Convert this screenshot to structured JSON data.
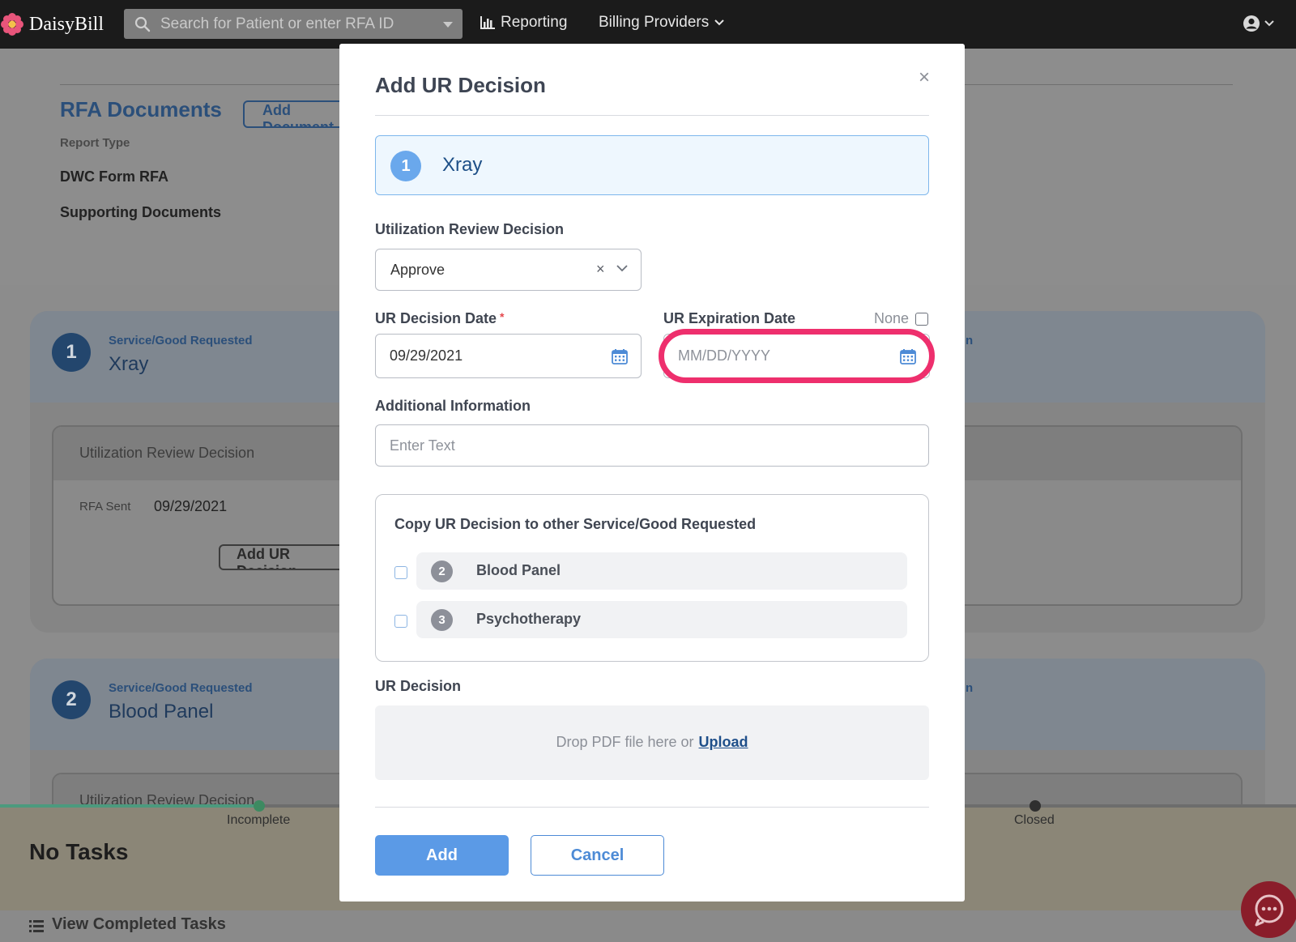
{
  "app": {
    "name": "DaisyBill",
    "search_placeholder": "Search for Patient or enter RFA ID",
    "nav": {
      "reporting": "Reporting",
      "billing_providers": "Billing Providers"
    }
  },
  "background": {
    "rfa_documents_title": "RFA Documents",
    "add_document_label": "Add Document",
    "report_type_label": "Report Type",
    "documents": [
      "DWC Form RFA",
      "Supporting Documents"
    ],
    "service_subtitle": "Service/Good Requested",
    "services": [
      {
        "num": "1",
        "name": "Xray"
      },
      {
        "num": "2",
        "name": "Blood Panel"
      }
    ],
    "ur_section_title": "Utilization Review Decision",
    "rfa_sent_label": "RFA Sent",
    "rfa_sent_value": "09/29/2021",
    "add_ur_button": "Add UR Decision",
    "right_header_fragment": "n"
  },
  "tasks": {
    "stage_incomplete": "Incomplete",
    "stage_closed": "Closed",
    "no_tasks": "No Tasks",
    "view_completed": "View Completed Tasks"
  },
  "modal": {
    "title": "Add UR Decision",
    "close_symbol": "×",
    "service": {
      "num": "1",
      "name": "Xray"
    },
    "ur_decision_label": "Utilization Review Decision",
    "ur_decision_value": "Approve",
    "ur_decision_clear": "×",
    "decision_date_label": "UR Decision Date",
    "required_mark": "*",
    "decision_date_value": "09/29/2021",
    "expiration_date_label": "UR Expiration Date",
    "expiration_placeholder": "MM/DD/YYYY",
    "none_label": "None",
    "additional_info_label": "Additional Information",
    "additional_info_placeholder": "Enter Text",
    "copy_title": "Copy UR Decision to other Service/Good Requested",
    "copy_items": [
      {
        "num": "2",
        "name": "Blood Panel"
      },
      {
        "num": "3",
        "name": "Psychotherapy"
      }
    ],
    "ur_file_label": "UR Decision",
    "drop_text": "Drop PDF file here or",
    "upload_link": "Upload",
    "add_button": "Add",
    "cancel_button": "Cancel"
  },
  "colors": {
    "accent_blue": "#5b9ae6",
    "highlight_pink": "#ee2f6d",
    "navy": "#1d4f87"
  }
}
